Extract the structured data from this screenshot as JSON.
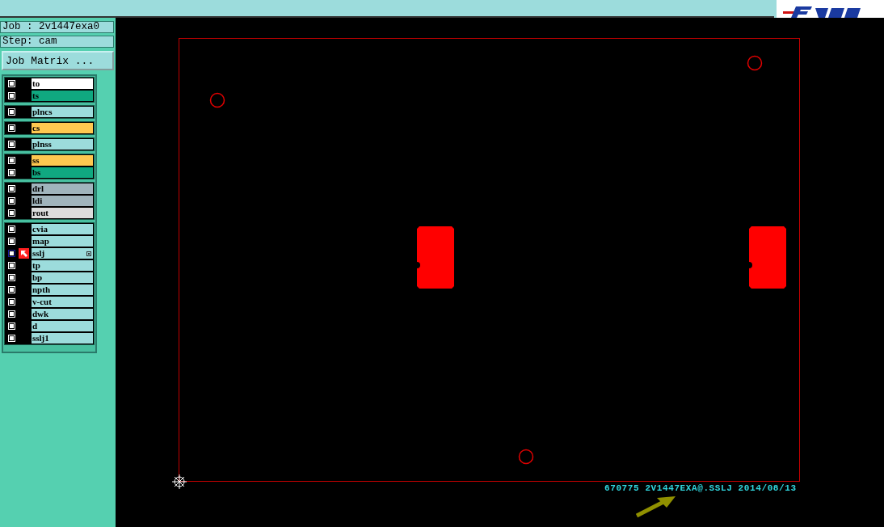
{
  "job": {
    "label": "Job : 2v1447exa0"
  },
  "step": {
    "label": "Step: cam"
  },
  "job_matrix_button": "Job Matrix ...",
  "layer_groups": [
    {
      "layers": [
        {
          "name": "to",
          "color": "#ffffff",
          "checked": true,
          "selected": false
        },
        {
          "name": "ts",
          "color": "#10a880",
          "checked": true,
          "selected": false
        }
      ]
    },
    {
      "layers": [
        {
          "name": "plncs",
          "color": "#9cdcdc",
          "checked": true,
          "selected": false
        }
      ]
    },
    {
      "layers": [
        {
          "name": "cs",
          "color": "#ffc850",
          "checked": true,
          "selected": false
        }
      ]
    },
    {
      "layers": [
        {
          "name": "plnss",
          "color": "#9cdcdc",
          "checked": true,
          "selected": false
        }
      ]
    },
    {
      "layers": [
        {
          "name": "ss",
          "color": "#ffc850",
          "checked": true,
          "selected": false
        },
        {
          "name": "bs",
          "color": "#10a880",
          "checked": true,
          "selected": false
        }
      ]
    },
    {
      "layers": [
        {
          "name": "drl",
          "color": "#a0b4bc",
          "checked": true,
          "selected": false
        },
        {
          "name": "ldi",
          "color": "#a0b4bc",
          "checked": true,
          "selected": false
        },
        {
          "name": "rout",
          "color": "#dcdcdc",
          "checked": true,
          "selected": false
        }
      ]
    },
    {
      "layers": [
        {
          "name": "cvia",
          "color": "#9cdcdc",
          "checked": true,
          "selected": false
        },
        {
          "name": "map",
          "color": "#9cdcdc",
          "checked": true,
          "selected": false
        },
        {
          "name": "sslj",
          "color": "#9cdcdc",
          "checked": true,
          "selected": true
        },
        {
          "name": "tp",
          "color": "#9cdcdc",
          "checked": true,
          "selected": false
        },
        {
          "name": "bp",
          "color": "#9cdcdc",
          "checked": true,
          "selected": false
        },
        {
          "name": "npth",
          "color": "#9cdcdc",
          "checked": true,
          "selected": false
        },
        {
          "name": "v-cut",
          "color": "#9cdcdc",
          "checked": true,
          "selected": false
        },
        {
          "name": "dwk",
          "color": "#9cdcdc",
          "checked": true,
          "selected": false
        },
        {
          "name": "d",
          "color": "#9cdcdc",
          "checked": true,
          "selected": false
        },
        {
          "name": "sslj1",
          "color": "#9cdcdc",
          "checked": true,
          "selected": false
        }
      ]
    }
  ],
  "canvas": {
    "stamp": "670775 2V1447EXA@.SSLJ 2014/08/13"
  }
}
